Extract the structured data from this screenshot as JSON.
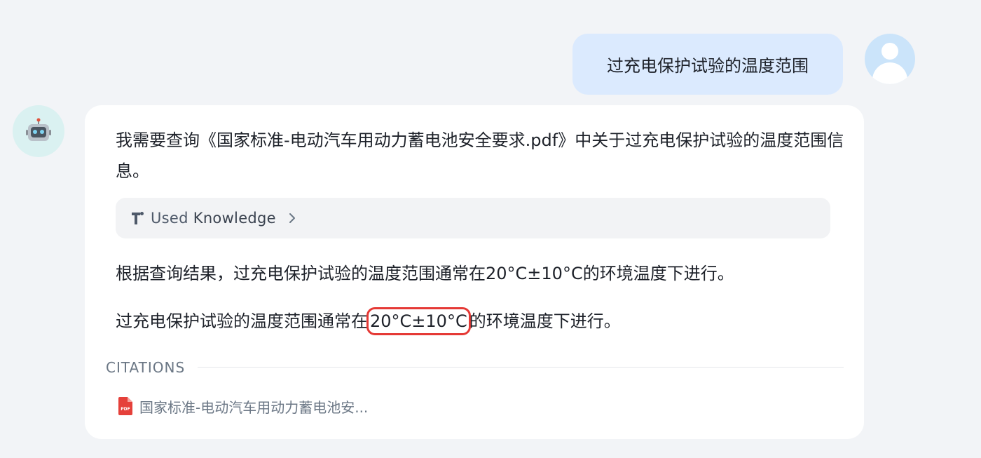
{
  "user": {
    "message": "过充电保护试验的温度范围"
  },
  "assistant": {
    "intro": "我需要查询《国家标准-电动汽车用动力蓄电池安全要求.pdf》中关于过充电保护试验的温度范围信息。",
    "knowledge": {
      "label_used": "Used",
      "label_knowledge": "Knowledge"
    },
    "answer_line1": "根据查询结果，过充电保护试验的温度范围通常在20°C±10°C的环境温度下进行。",
    "answer_line2_before": "过充电保护试验的温度范围通常在",
    "answer_line2_highlight": "20°C±10°C",
    "answer_line2_after": "的环境温度下进行。",
    "citations": {
      "title": "CITATIONS",
      "items": [
        {
          "name": "国家标准-电动汽车用动力蓄电池安...",
          "icon": "pdf-icon",
          "icon_label": "PDF"
        }
      ]
    }
  },
  "colors": {
    "user_bubble": "#dbeafe",
    "highlight_border": "#e53935",
    "pdf_red": "#e5403a"
  }
}
